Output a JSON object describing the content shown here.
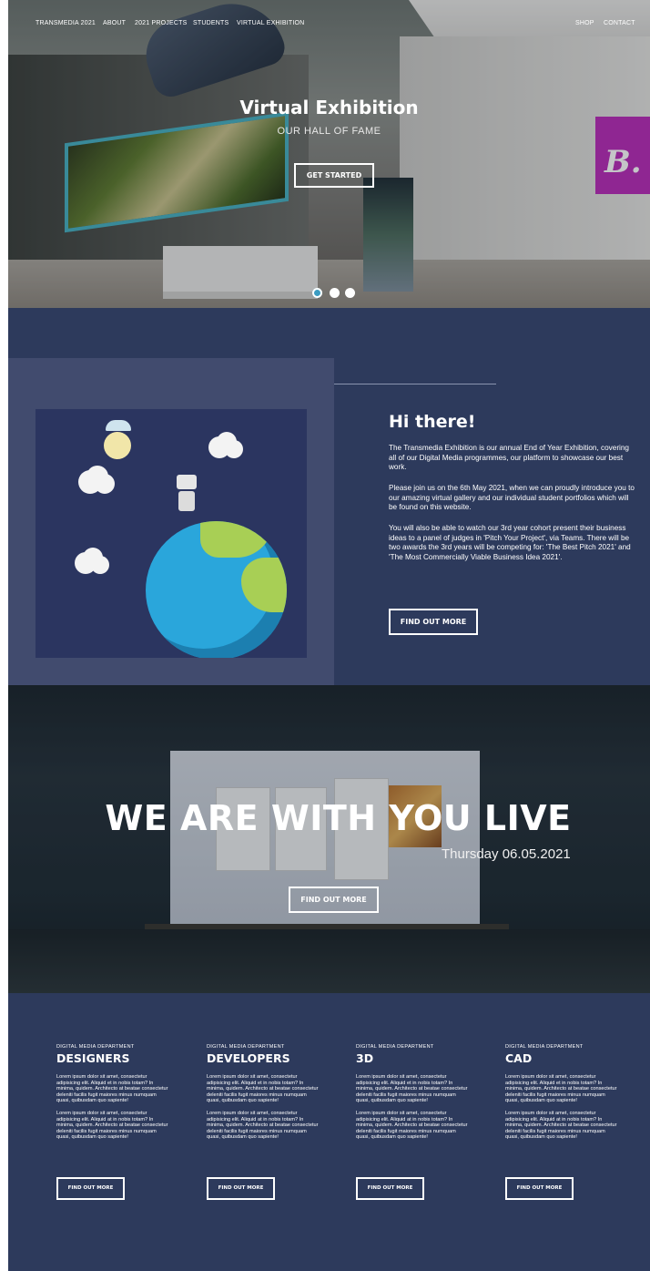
{
  "nav": {
    "brand": "TRANSMEDIA 2021",
    "items": [
      "ABOUT",
      "2021 PROJECTS",
      "STUDENTS",
      "VIRTUAL EXHIBITION"
    ],
    "right_items": [
      "SHOP",
      "CONTACT"
    ]
  },
  "hero": {
    "title": "Virtual Exhibition",
    "subtitle": "OUR HALL OF FAME",
    "button": "GET STARTED",
    "sign_letter": "B.",
    "slide_dots": 3,
    "active_slide": 1
  },
  "intro": {
    "title": "Hi there!",
    "paragraphs": [
      "The Transmedia Exhibition is our annual End of Year Exhibition, covering all of our Digital Media programmes, our platform to showcase our best work.",
      "Please join us on the 6th May 2021, when we can proudly introduce you to our amazing virtual gallery and our individual student portfolios which will be found on this website.",
      "You will also be able to watch our 3rd year cohort present their business ideas to a panel of judges in 'Pitch Your Project', via Teams. There will be two awards the 3rd years will be competing for: 'The Best Pitch 2021' and 'The Most Commercially Viable Business Idea 2021'."
    ],
    "button": "FIND OUT MORE"
  },
  "live": {
    "title": "WE ARE WITH YOU LIVE",
    "date": "Thursday 06.05.2021",
    "button": "FIND OUT MORE"
  },
  "departments": [
    {
      "kicker": "DIGITAL MEDIA DEPARTMENT",
      "name": "DESIGNERS",
      "para1": "Lorem ipsum dolor sit amet, consectetur adipisicing elit. Aliquid et in nobis totam? In minima, quidem. Architecto at beatae consectetur deleniti facilis fugit maiores minus numquam quasi, quibusdam quo sapiente!",
      "para2": "Lorem ipsum dolor sit amet, consectetur adipisicing elit. Aliquid at in nobis totam? In minima, quidem. Architecto at beatae consectetur deleniti facilis fugit maiores minus numquam quasi, quibusdam quo sapiente!",
      "button": "FIND OUT MORE"
    },
    {
      "kicker": "DIGITAL MEDIA DEPARTMENT",
      "name": "DEVELOPERS",
      "para1": "Lorem ipsum dolor sit amet, consectetur adipisicing elit. Aliquid et in nobis totam? In minima, quidem. Architecto at beatae consectetur deleniti facilis fugit maiores minus numquam quasi, quibusdam quo sapiente!",
      "para2": "Lorem ipsum dolor sit amet, consectetur adipisicing elit. Aliquid at in nobis totam? In minima, quidem. Architecto at beatae consectetur deleniti facilis fugit maiores minus numquam quasi, quibusdam quo sapiente!",
      "button": "FIND OUT MORE"
    },
    {
      "kicker": "DIGITAL MEDIA DEPARTMENT",
      "name": "3D",
      "para1": "Lorem ipsum dolor sit amet, consectetur adipisicing elit. Aliquid et in nobis totam? In minima, quidem. Architecto at beatae consectetur deleniti facilis fugit maiores minus numquam quasi, quibusdam quo sapiente!",
      "para2": "Lorem ipsum dolor sit amet, consectetur adipisicing elit. Aliquid at in nobis totam? In minima, quidem. Architecto at beatae consectetur deleniti facilis fugit maiores minus numquam quasi, quibusdam quo sapiente!",
      "button": "FIND OUT MORE"
    },
    {
      "kicker": "DIGITAL MEDIA DEPARTMENT",
      "name": "CAD",
      "para1": "Lorem ipsum dolor sit amet, consectetur adipisicing elit. Aliquid et in nobis totam? In minima, quidem. Architecto at beatae consectetur deleniti facilis fugit maiores minus numquam quasi, quibusdam quo sapiente!",
      "para2": "Lorem ipsum dolor sit amet, consectetur adipisicing elit. Aliquid at in nobis totam? In minima, quidem. Architecto at beatae consectetur deleniti facilis fugit maiores minus numquam quasi, quibusdam quo sapiente!",
      "button": "FIND OUT MORE"
    }
  ],
  "colors": {
    "page_background": "#2d3a5c",
    "panel": "#414b6e",
    "button_border": "#ffffff",
    "active_dot": "#3b9cc2",
    "sign": "#b82bb8",
    "painting_frame": "#46b1c2"
  }
}
